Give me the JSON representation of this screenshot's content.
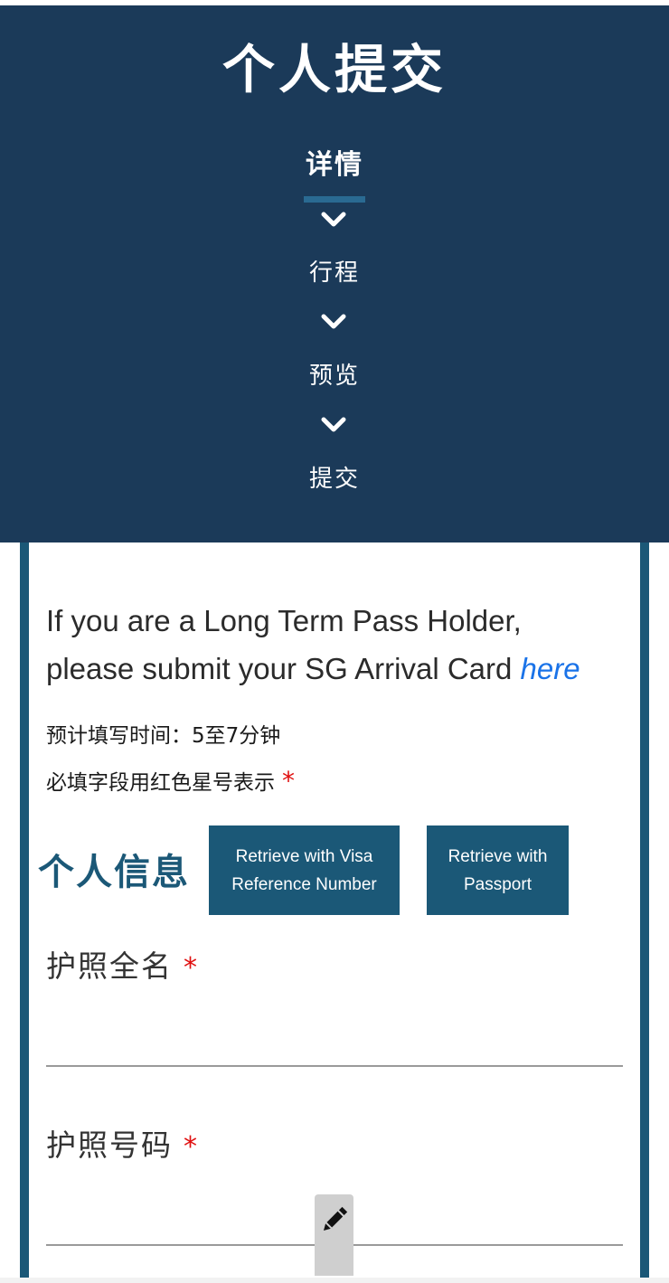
{
  "header": {
    "title": "个人提交",
    "steps": [
      {
        "label": "详情",
        "active": true
      },
      {
        "label": "行程",
        "active": false
      },
      {
        "label": "预览",
        "active": false
      },
      {
        "label": "提交",
        "active": false
      }
    ]
  },
  "notice": {
    "line1": "If you are a Long Term Pass Holder,",
    "line2_prefix": "please submit your SG Arrival Card ",
    "link_text": "here"
  },
  "meta": {
    "estimated_time": "预计填写时间：5至7分钟",
    "required_hint": "必填字段用红色星号表示",
    "required_mark": "*"
  },
  "personal_info": {
    "title": "个人信息",
    "retrieve_visa_line1": "Retrieve with Visa",
    "retrieve_visa_line2": "Reference Number",
    "retrieve_passport_line1": "Retrieve with",
    "retrieve_passport_line2": "Passport"
  },
  "fields": {
    "passport_name_label": "护照全名",
    "passport_name_value": "",
    "passport_number_label": "护照号码",
    "passport_number_value": ""
  },
  "colors": {
    "header_bg": "#1b3a59",
    "accent": "#1b5877",
    "link": "#1a73e8",
    "required": "#e01010"
  },
  "icons": {
    "step_separator": "chevron-down-icon",
    "edit": "pencil-icon"
  }
}
